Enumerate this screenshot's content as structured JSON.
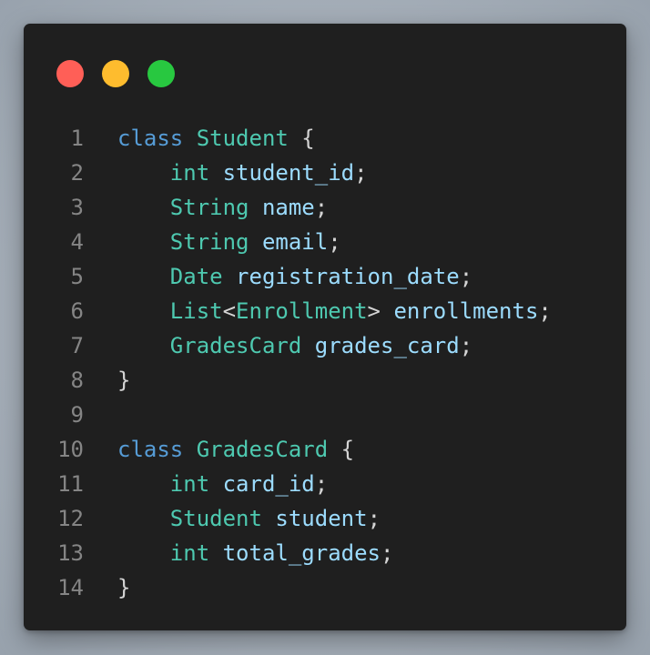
{
  "colors": {
    "window_bg": "#1f1f1f",
    "dot_red": "#ff5f57",
    "dot_yellow": "#febc2e",
    "dot_green": "#28c840",
    "keyword": "#569cd6",
    "type": "#4ec9b0",
    "identifier": "#9cdcfe",
    "punctuation": "#d4d4d4",
    "line_number": "#858585"
  },
  "window_controls": [
    {
      "name": "close",
      "color": "#ff5f57"
    },
    {
      "name": "minimize",
      "color": "#febc2e"
    },
    {
      "name": "maximize",
      "color": "#28c840"
    }
  ],
  "code": {
    "language": "java",
    "lines": [
      {
        "number": "1",
        "tokens": [
          {
            "t": "class",
            "k": "kw"
          },
          {
            "t": " ",
            "k": "ws"
          },
          {
            "t": "Student",
            "k": "type"
          },
          {
            "t": " {",
            "k": "punct"
          }
        ]
      },
      {
        "number": "2",
        "tokens": [
          {
            "t": "    ",
            "k": "ws"
          },
          {
            "t": "int",
            "k": "type"
          },
          {
            "t": " ",
            "k": "ws"
          },
          {
            "t": "student_id",
            "k": "id"
          },
          {
            "t": ";",
            "k": "punct"
          }
        ]
      },
      {
        "number": "3",
        "tokens": [
          {
            "t": "    ",
            "k": "ws"
          },
          {
            "t": "String",
            "k": "type"
          },
          {
            "t": " ",
            "k": "ws"
          },
          {
            "t": "name",
            "k": "id"
          },
          {
            "t": ";",
            "k": "punct"
          }
        ]
      },
      {
        "number": "4",
        "tokens": [
          {
            "t": "    ",
            "k": "ws"
          },
          {
            "t": "String",
            "k": "type"
          },
          {
            "t": " ",
            "k": "ws"
          },
          {
            "t": "email",
            "k": "id"
          },
          {
            "t": ";",
            "k": "punct"
          }
        ]
      },
      {
        "number": "5",
        "tokens": [
          {
            "t": "    ",
            "k": "ws"
          },
          {
            "t": "Date",
            "k": "type"
          },
          {
            "t": " ",
            "k": "ws"
          },
          {
            "t": "registration_date",
            "k": "id"
          },
          {
            "t": ";",
            "k": "punct"
          }
        ]
      },
      {
        "number": "6",
        "tokens": [
          {
            "t": "    ",
            "k": "ws"
          },
          {
            "t": "List",
            "k": "type"
          },
          {
            "t": "<",
            "k": "punct"
          },
          {
            "t": "Enrollment",
            "k": "type"
          },
          {
            "t": ">",
            "k": "punct"
          },
          {
            "t": " ",
            "k": "ws"
          },
          {
            "t": "enrollments",
            "k": "id"
          },
          {
            "t": ";",
            "k": "punct"
          }
        ]
      },
      {
        "number": "7",
        "tokens": [
          {
            "t": "    ",
            "k": "ws"
          },
          {
            "t": "GradesCard",
            "k": "type"
          },
          {
            "t": " ",
            "k": "ws"
          },
          {
            "t": "grades_card",
            "k": "id"
          },
          {
            "t": ";",
            "k": "punct"
          }
        ]
      },
      {
        "number": "8",
        "tokens": [
          {
            "t": "}",
            "k": "punct"
          }
        ]
      },
      {
        "number": "9",
        "tokens": []
      },
      {
        "number": "10",
        "tokens": [
          {
            "t": "class",
            "k": "kw"
          },
          {
            "t": " ",
            "k": "ws"
          },
          {
            "t": "GradesCard",
            "k": "type"
          },
          {
            "t": " {",
            "k": "punct"
          }
        ]
      },
      {
        "number": "11",
        "tokens": [
          {
            "t": "    ",
            "k": "ws"
          },
          {
            "t": "int",
            "k": "type"
          },
          {
            "t": " ",
            "k": "ws"
          },
          {
            "t": "card_id",
            "k": "id"
          },
          {
            "t": ";",
            "k": "punct"
          }
        ]
      },
      {
        "number": "12",
        "tokens": [
          {
            "t": "    ",
            "k": "ws"
          },
          {
            "t": "Student",
            "k": "type"
          },
          {
            "t": " ",
            "k": "ws"
          },
          {
            "t": "student",
            "k": "id"
          },
          {
            "t": ";",
            "k": "punct"
          }
        ]
      },
      {
        "number": "13",
        "tokens": [
          {
            "t": "    ",
            "k": "ws"
          },
          {
            "t": "int",
            "k": "type"
          },
          {
            "t": " ",
            "k": "ws"
          },
          {
            "t": "total_grades",
            "k": "id"
          },
          {
            "t": ";",
            "k": "punct"
          }
        ]
      },
      {
        "number": "14",
        "tokens": [
          {
            "t": "}",
            "k": "punct"
          }
        ]
      }
    ]
  }
}
